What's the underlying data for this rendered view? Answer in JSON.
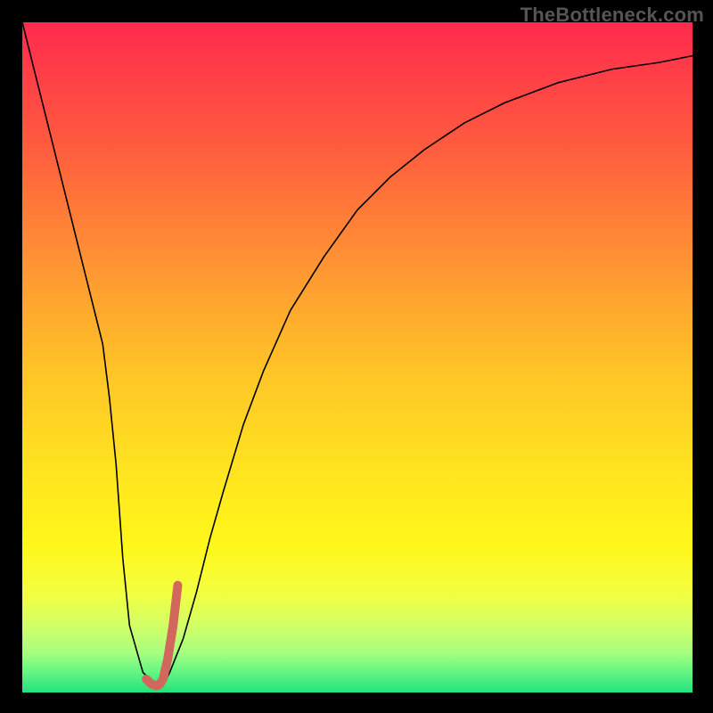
{
  "watermark": "TheBottleneck.com",
  "chart_data": {
    "type": "line",
    "title": "",
    "xlabel": "",
    "ylabel": "",
    "xlim": [
      0,
      100
    ],
    "ylim": [
      0,
      100
    ],
    "grid": false,
    "legend": false,
    "background_gradient": {
      "stops": [
        {
          "offset": 0.0,
          "color": "#ff2a4e"
        },
        {
          "offset": 0.18,
          "color": "#ff5a3f"
        },
        {
          "offset": 0.36,
          "color": "#ff9433"
        },
        {
          "offset": 0.52,
          "color": "#ffc427"
        },
        {
          "offset": 0.68,
          "color": "#ffe61f"
        },
        {
          "offset": 0.78,
          "color": "#fff71a"
        },
        {
          "offset": 0.85,
          "color": "#f3ff3f"
        },
        {
          "offset": 0.9,
          "color": "#d2ff66"
        },
        {
          "offset": 0.94,
          "color": "#a8ff80"
        },
        {
          "offset": 0.97,
          "color": "#63f582"
        },
        {
          "offset": 1.0,
          "color": "#22e27e"
        }
      ]
    },
    "series": [
      {
        "name": "bottleneck-curve",
        "stroke": "#000000",
        "stroke_width": 1.6,
        "x": [
          0,
          2,
          4,
          6,
          8,
          10,
          11,
          12,
          13,
          14,
          15,
          16,
          18,
          20,
          21,
          22,
          24,
          26,
          28,
          30,
          33,
          36,
          40,
          45,
          50,
          55,
          60,
          66,
          72,
          80,
          88,
          95,
          100
        ],
        "values": [
          100,
          92,
          84,
          76,
          68,
          60,
          56,
          52,
          44,
          34,
          20,
          10,
          3,
          1,
          1,
          3,
          8,
          15,
          23,
          30,
          40,
          48,
          57,
          65,
          72,
          77,
          81,
          85,
          88,
          91,
          93,
          94,
          95
        ]
      },
      {
        "name": "marker-segment",
        "stroke": "#d2675b",
        "stroke_width": 10,
        "linecap": "round",
        "x": [
          18.5,
          19.2,
          20.0,
          20.5,
          21.0,
          21.7,
          22.5,
          23.2
        ],
        "values": [
          2.0,
          1.3,
          1.0,
          1.2,
          2.0,
          5.0,
          10.0,
          16.0
        ]
      }
    ]
  }
}
